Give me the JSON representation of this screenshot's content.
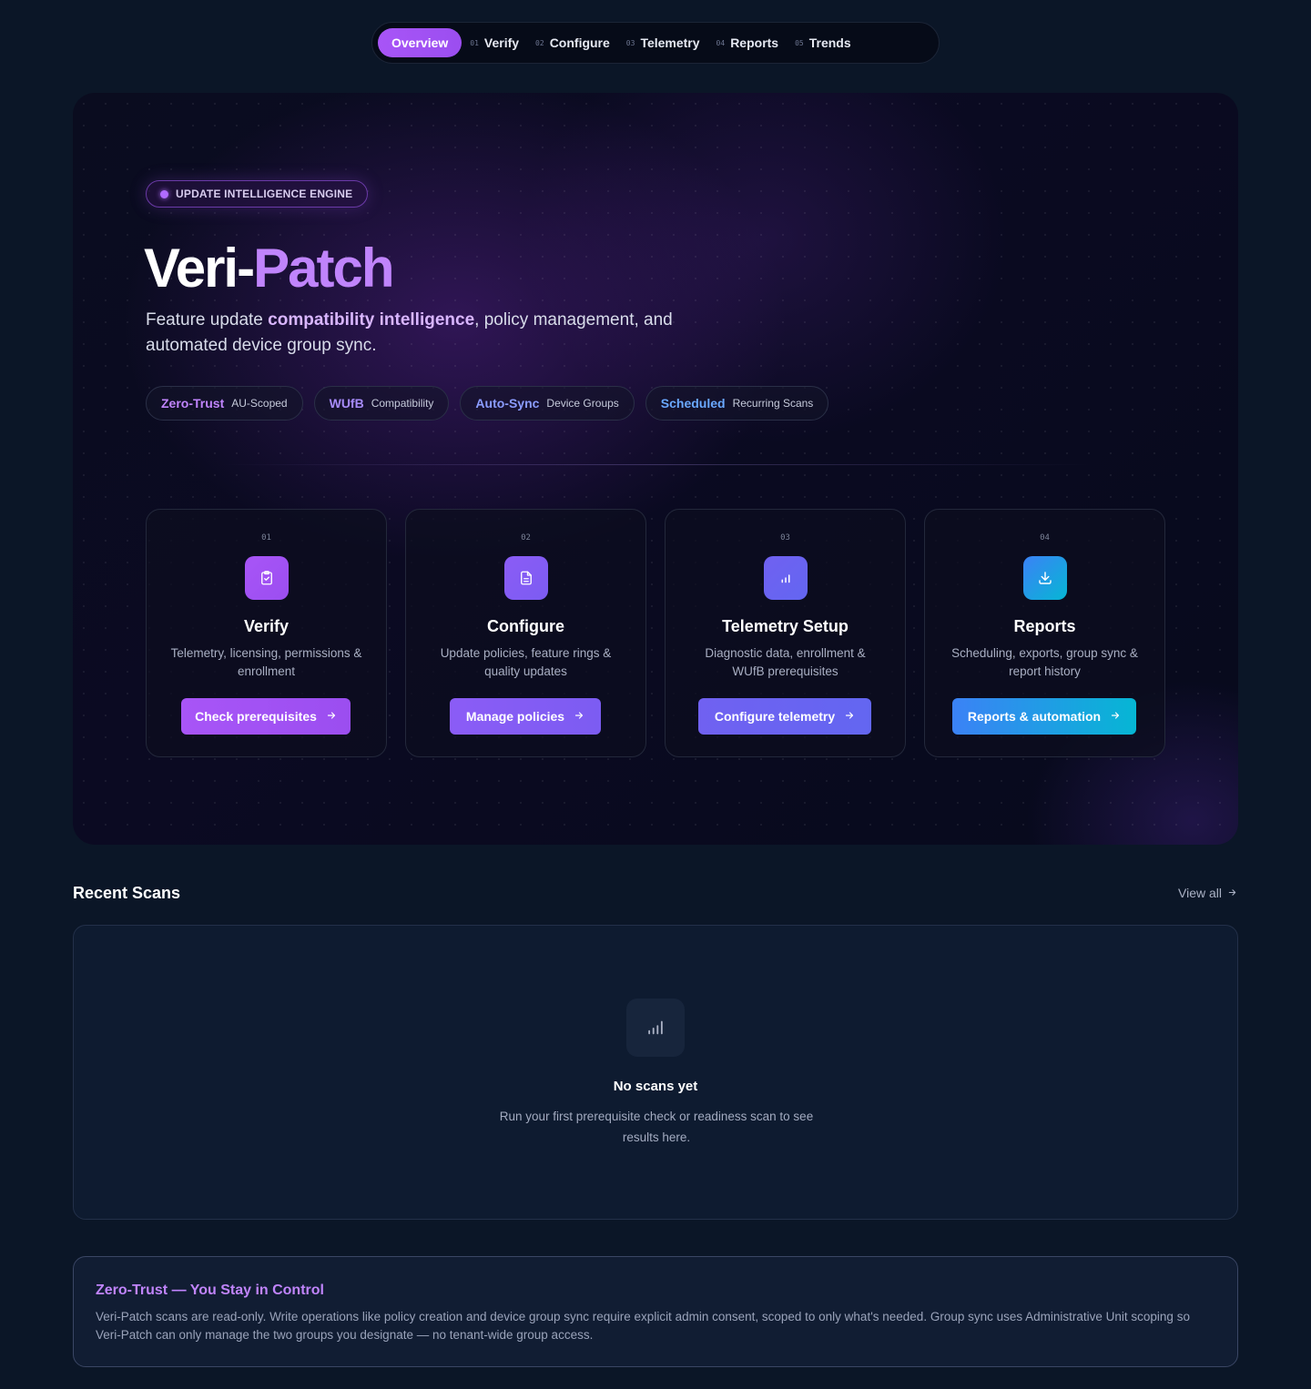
{
  "nav": {
    "tabs": [
      {
        "num": "",
        "label": "Overview",
        "active": true
      },
      {
        "num": "01",
        "label": "Verify"
      },
      {
        "num": "02",
        "label": "Configure"
      },
      {
        "num": "03",
        "label": "Telemetry"
      },
      {
        "num": "04",
        "label": "Reports"
      },
      {
        "num": "05",
        "label": "Trends"
      }
    ]
  },
  "hero": {
    "badge": "UPDATE INTELLIGENCE ENGINE",
    "title_main": "Veri-",
    "title_accent": "Patch",
    "subtitle_pre": "Feature update ",
    "subtitle_highlight": "compatibility intelligence",
    "subtitle_post": ", policy management, and automated device group sync.",
    "chips": [
      {
        "key": "Zero-Trust",
        "value": "AU-Scoped",
        "color": "#c084fc"
      },
      {
        "key": "WUfB",
        "value": "Compatibility",
        "color": "#a78bfa"
      },
      {
        "key": "Auto-Sync",
        "value": "Device Groups",
        "color": "#8b9cff"
      },
      {
        "key": "Scheduled",
        "value": "Recurring Scans",
        "color": "#6aa8ff"
      }
    ],
    "cards": [
      {
        "num": "01",
        "icon": "clipboard-check-icon",
        "title": "Verify",
        "desc": "Telemetry, licensing, permissions & enrollment",
        "button": "Check prerequisites",
        "colors": [
          "#a855f7",
          "#9b4ef0"
        ]
      },
      {
        "num": "02",
        "icon": "document-icon",
        "title": "Configure",
        "desc": "Update policies, feature rings & quality updates",
        "button": "Manage policies",
        "colors": [
          "#8b5cf6",
          "#7c5cf2"
        ]
      },
      {
        "num": "03",
        "icon": "bar-chart-icon",
        "title": "Telemetry Setup",
        "desc": "Diagnostic data, enrollment & WUfB prerequisites",
        "button": "Configure telemetry",
        "colors": [
          "#7061f1",
          "#6366f1"
        ]
      },
      {
        "num": "04",
        "icon": "download-icon",
        "title": "Reports",
        "desc": "Scheduling, exports, group sync & report history",
        "button": "Reports & automation",
        "colors": [
          "#3b82f6",
          "#06b6d4"
        ]
      }
    ]
  },
  "scans": {
    "title": "Recent Scans",
    "view_all": "View all",
    "empty_title": "No scans yet",
    "empty_desc": "Run your first prerequisite check or readiness scan to see results here."
  },
  "zero_trust": {
    "title": "Zero-Trust — You Stay in Control",
    "body": "Veri-Patch scans are read-only. Write operations like policy creation and device group sync require explicit admin consent, scoped to only what's needed. Group sync uses Administrative Unit scoping so Veri-Patch can only manage the two groups you designate — no tenant-wide group access."
  }
}
